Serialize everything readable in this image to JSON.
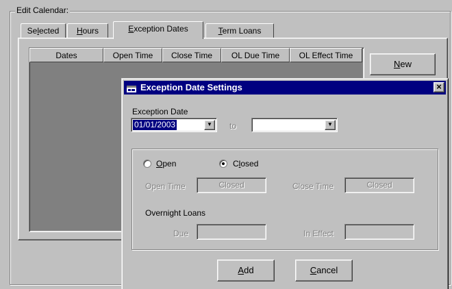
{
  "edit_calendar": {
    "group_label": "Edit Calendar:",
    "tabs": [
      {
        "label": "Selected",
        "mnemonic": "l"
      },
      {
        "label": "Hours",
        "mnemonic": "H"
      },
      {
        "label": "Exception Dates",
        "mnemonic": "E",
        "active": true
      },
      {
        "label": "Term Loans",
        "mnemonic": "T"
      }
    ],
    "grid_columns": [
      "Dates",
      "Open Time",
      "Close Time",
      "OL Due Time",
      "OL Effect Time"
    ],
    "new_button": "New"
  },
  "dialog": {
    "title": "Exception Date Settings",
    "close_icon": "close-icon",
    "exception_date_label": "Exception Date",
    "from_date_value": "01/01/2003",
    "to_label": "to",
    "to_date_value": "",
    "open_radio_label": "Open",
    "closed_radio_label": "Closed",
    "selected_radio": "closed",
    "open_time_label": "Open Time",
    "open_time_value": "Closed",
    "close_time_label": "Close Time",
    "close_time_value": "Closed",
    "overnight_loans_label": "Overnight Loans",
    "due_label": "Due",
    "due_value": "",
    "in_effect_label": "In Effect",
    "in_effect_value": "",
    "add_button": "Add",
    "cancel_button": "Cancel"
  },
  "colors": {
    "face": "#c0c0c0",
    "title_bar": "#000080",
    "grid_background": "#808080",
    "selection": "#000080"
  }
}
